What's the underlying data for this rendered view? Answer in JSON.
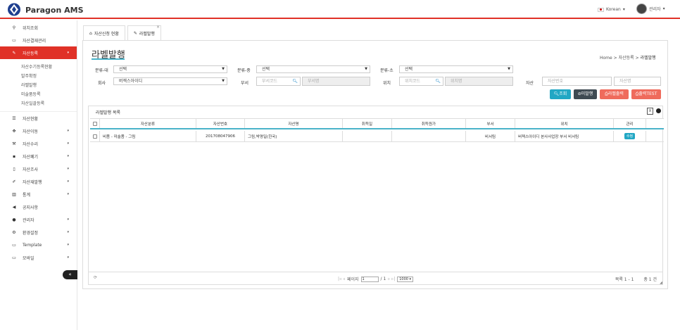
{
  "app": {
    "name": "Paragon AMS"
  },
  "header": {
    "language": "Korean",
    "user": "관리자"
  },
  "sidebar": {
    "items": [
      {
        "label": "위치조회",
        "icon": "map-marker-icon"
      },
      {
        "label": "자산결재관리",
        "icon": "folder-open-icon"
      },
      {
        "label": "자산등록",
        "icon": "pencil-icon",
        "active": true
      }
    ],
    "sub_items": [
      "자산수기등록현황",
      "발주확정",
      "라벨발행",
      "미술품등록",
      "자산일괄등록"
    ],
    "items2": [
      {
        "label": "자산현황",
        "icon": "list-icon"
      },
      {
        "label": "자산이동",
        "icon": "move-icon"
      },
      {
        "label": "자산수리",
        "icon": "wrench-icon"
      },
      {
        "label": "자산폐기",
        "icon": "trash-icon"
      },
      {
        "label": "자산조사",
        "icon": "mobile-icon"
      },
      {
        "label": "자산재발행",
        "icon": "edit-icon"
      },
      {
        "label": "통계",
        "icon": "bar-chart-icon"
      },
      {
        "label": "공지사항",
        "icon": "bullhorn-icon"
      },
      {
        "label": "관리자",
        "icon": "user-icon"
      },
      {
        "label": "환경설정",
        "icon": "cogs-icon"
      },
      {
        "label": "Template",
        "icon": "folder-icon"
      },
      {
        "label": "모바일",
        "icon": "folder-icon"
      }
    ],
    "toggle": "«"
  },
  "tabs": [
    {
      "label": "자산신청 현황",
      "icon": "home-icon"
    },
    {
      "label": "라벨발행",
      "icon": "pencil-icon",
      "close": "×"
    }
  ],
  "page": {
    "title": "라벨발행",
    "breadcrumb": {
      "home": "Home",
      "sep": ">",
      "parent": "자산등록",
      "current": "라벨발행"
    }
  },
  "filters": {
    "cat_big": {
      "label": "분류-대",
      "value": "선택"
    },
    "cat_mid": {
      "label": "분류-중",
      "value": "선택"
    },
    "cat_small": {
      "label": "분류-소",
      "value": "선택"
    },
    "company": {
      "label": "회사",
      "value": "버젝스아이디"
    },
    "dept": {
      "label": "부서",
      "code_placeholder": "부서코드",
      "name_placeholder": "부서명"
    },
    "location": {
      "label": "위치",
      "code_placeholder": "위치코드",
      "name_placeholder": "위치명"
    },
    "asset": {
      "label": "자산",
      "no_placeholder": "자산번호",
      "name_placeholder": "자산명"
    }
  },
  "buttons": {
    "search": "조회",
    "unissued": "미발행",
    "label_print": "라벨출력",
    "print_test": "출력TEST"
  },
  "colors": {
    "search": "#22a7c4",
    "unissued": "#3f4a52",
    "print": "#ef6b5c",
    "accent": "#e03127"
  },
  "grid": {
    "caption": "라벨발행 목록",
    "columns": [
      "자산분류",
      "자산번호",
      "자산명",
      "취득일",
      "취득원가",
      "부서",
      "위치",
      "관리"
    ],
    "rows": [
      {
        "category": "비품 - 미술품 - 그림",
        "asset_no": "201708047906",
        "asset_name": "그림,박명일(한국)",
        "acq_date": "",
        "acq_cost": "",
        "dept": "비서팀",
        "location": "버젝스아이디 본사사업장 부서 비서팀",
        "action": "수정"
      }
    ],
    "pager": {
      "prev": "|◃ ◃",
      "page_label": "페이지",
      "page": "1",
      "of": "/ 1",
      "next": "▹ ▹|",
      "size": "1000",
      "info": "목록 1 - 1",
      "total": "총 1 건"
    }
  }
}
